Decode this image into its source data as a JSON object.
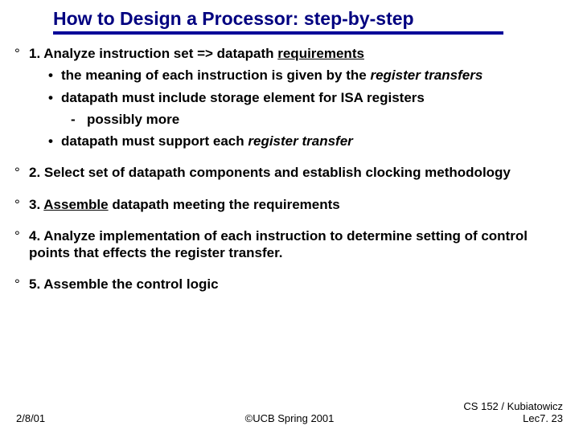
{
  "title": "How to Design a Processor: step-by-step",
  "steps": {
    "s1": {
      "main_a": "1. Analyze instruction set => datapath ",
      "main_b": "requirements",
      "sub1": "the meaning of each instruction is given by the ",
      "sub1_em": "register transfers",
      "sub2": "datapath must include storage element for ISA registers",
      "sub2a": "possibly more",
      "sub3": "datapath must support each ",
      "sub3_em": "register transfer"
    },
    "s2": "2. Select set of datapath components and establish clocking methodology",
    "s3_a": "3. ",
    "s3_b": "Assemble",
    "s3_c": " datapath meeting the requirements",
    "s4": "4. Analyze implementation of each instruction to determine setting of control points that effects the register transfer.",
    "s5": "5. Assemble the control logic"
  },
  "footer": {
    "date": "2/8/01",
    "center": "©UCB Spring 2001",
    "right": "CS 152 / Kubiatowicz\nLec7. 23"
  }
}
